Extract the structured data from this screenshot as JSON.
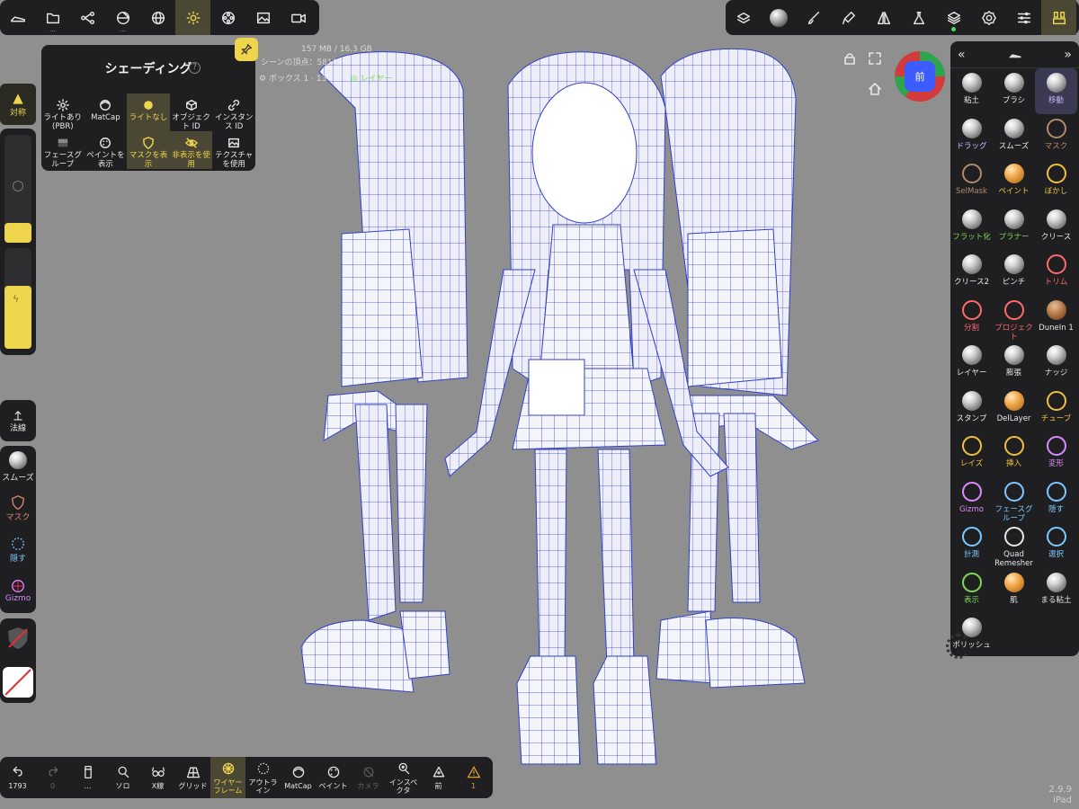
{
  "top_toolbar": {
    "left_icons": [
      "shoe-icon",
      "folder-icon",
      "scene-graph-icon",
      "mesh-icon",
      "sphere-icon",
      "sun-icon",
      "film-reel-icon",
      "image-icon",
      "camera-icon"
    ],
    "right_icons": [
      "stack-icon",
      "matcap-icon",
      "brush-icon",
      "paint-icon",
      "symmetry-icon",
      "flask-icon",
      "layers-icon",
      "settings-icon",
      "sliders-icon",
      "tool-panel-icon"
    ]
  },
  "shading_popup": {
    "title": "シェーディング",
    "help": "?",
    "options": [
      {
        "label": "ライトあり (PBR)",
        "icon": "sun-icon",
        "selected": false
      },
      {
        "label": "MatCap",
        "icon": "matcap-icon",
        "selected": false
      },
      {
        "label": "ライトなし",
        "icon": "circle-icon",
        "selected": true
      },
      {
        "label": "オブジェクト ID",
        "icon": "cube-icon",
        "selected": false
      },
      {
        "label": "インスタンス ID",
        "icon": "link-icon",
        "selected": false
      },
      {
        "label": "フェースグループ",
        "icon": "facegroup-icon",
        "selected": false
      },
      {
        "label": "ペイントを表示",
        "icon": "palette-icon",
        "selected": false
      },
      {
        "label": "マスクを表示",
        "icon": "shield-icon",
        "selected": true
      },
      {
        "label": "非表示を使用",
        "icon": "eye-off-icon",
        "selected": true
      },
      {
        "label": "テクスチャを使用",
        "icon": "image-icon",
        "selected": false
      }
    ]
  },
  "info": {
    "memory": "157 MB / 16.3 GB",
    "scene_vertices": "シーンの頂点：5810",
    "object_name": "ボックス 1",
    "object_vertices": "13",
    "layer_label": "レイヤー"
  },
  "left_panel": {
    "symmetry_label": "対称",
    "normal_label": "法線",
    "smooth_label": "スムーズ",
    "mask_label": "マスク",
    "hide_label": "隠す",
    "gizmo_label": "Gizmo"
  },
  "view_cube": {
    "face": "前"
  },
  "right_panel": {
    "tools": [
      {
        "label": "粘土",
        "style": "ball",
        "color": "#e8e8e8"
      },
      {
        "label": "ブラシ",
        "style": "ball",
        "color": "#e8e8e8"
      },
      {
        "label": "移動",
        "style": "ball",
        "color": "#c9b8ff",
        "active": true
      },
      {
        "label": "ドラッグ",
        "style": "ball",
        "color": "#c9b8ff"
      },
      {
        "label": "スムーズ",
        "style": "ball",
        "color": "#e8e8e8"
      },
      {
        "label": "マスク",
        "style": "icon",
        "color": "#b08a6a"
      },
      {
        "label": "SelMask",
        "style": "icon",
        "color": "#b08a6a"
      },
      {
        "label": "ペイント",
        "style": "ball-o",
        "color": "#f0c040"
      },
      {
        "label": "ぼかし",
        "style": "icon",
        "color": "#f0c040"
      },
      {
        "label": "フラット化",
        "style": "ball",
        "color": "#7ed957"
      },
      {
        "label": "プラナー",
        "style": "ball",
        "color": "#7ed957"
      },
      {
        "label": "クリース",
        "style": "ball",
        "color": "#e8e8e8"
      },
      {
        "label": "クリース2",
        "style": "ball",
        "color": "#e8e8e8"
      },
      {
        "label": "ピンチ",
        "style": "ball",
        "color": "#e8e8e8"
      },
      {
        "label": "トリム",
        "style": "icon",
        "color": "#ff6b6b"
      },
      {
        "label": "分割",
        "style": "icon",
        "color": "#ff6b6b"
      },
      {
        "label": "プロジェクト",
        "style": "icon",
        "color": "#ff6b6b"
      },
      {
        "label": "DuneIn 1",
        "style": "ball-b",
        "color": "#e8e8e8"
      },
      {
        "label": "レイヤー",
        "style": "ball",
        "color": "#e8e8e8"
      },
      {
        "label": "膨張",
        "style": "ball",
        "color": "#e8e8e8"
      },
      {
        "label": "ナッジ",
        "style": "ball",
        "color": "#e8e8e8"
      },
      {
        "label": "スタンプ",
        "style": "ball",
        "color": "#e8e8e8"
      },
      {
        "label": "DelLayer",
        "style": "ball-o",
        "color": "#e8e8e8"
      },
      {
        "label": "チューブ",
        "style": "icon",
        "color": "#f0c040"
      },
      {
        "label": "レイズ",
        "style": "icon",
        "color": "#f0c040"
      },
      {
        "label": "挿入",
        "style": "icon",
        "color": "#f0c040"
      },
      {
        "label": "変形",
        "style": "icon",
        "color": "#d98cff"
      },
      {
        "label": "Gizmo",
        "style": "icon",
        "color": "#d98cff"
      },
      {
        "label": "フェースグループ",
        "style": "icon",
        "color": "#7cc8ff"
      },
      {
        "label": "隠す",
        "style": "icon",
        "color": "#7cc8ff"
      },
      {
        "label": "計測",
        "style": "icon",
        "color": "#7cc8ff"
      },
      {
        "label": "Quad Remesher",
        "style": "icon",
        "color": "#e8e8e8"
      },
      {
        "label": "選択",
        "style": "icon",
        "color": "#7cc8ff"
      },
      {
        "label": "表示",
        "style": "icon",
        "color": "#7ed957"
      },
      {
        "label": "肌",
        "style": "ball-o",
        "color": "#e8e8e8"
      },
      {
        "label": "まる粘土",
        "style": "ball",
        "color": "#e8e8e8"
      },
      {
        "label": "ポリッシュ",
        "style": "ball",
        "color": "#e8e8e8"
      }
    ]
  },
  "bottom_toolbar": {
    "items": [
      {
        "label": "1793",
        "icon": "undo-icon"
      },
      {
        "label": "0",
        "icon": "redo-icon",
        "dim": true
      },
      {
        "label": "...",
        "icon": "phone-icon"
      },
      {
        "label": "ソロ",
        "icon": "search-icon"
      },
      {
        "label": "X線",
        "icon": "glasses-icon"
      },
      {
        "label": "グリッド",
        "icon": "grid-icon"
      },
      {
        "label": "ワイヤーフレーム",
        "icon": "wireframe-icon",
        "on": true
      },
      {
        "label": "アウトライン",
        "icon": "outline-icon"
      },
      {
        "label": "MatCap",
        "icon": "matcap-icon"
      },
      {
        "label": "ペイント",
        "icon": "palette-icon"
      },
      {
        "label": "カメラ",
        "icon": "camera-off-icon",
        "dim": true
      },
      {
        "label": "インスペクタ",
        "icon": "inspector-icon"
      },
      {
        "label": "前",
        "icon": "view-icon"
      },
      {
        "label": "1",
        "icon": "warning-icon",
        "warn": true
      }
    ]
  },
  "version": {
    "number": "2.9.9",
    "device": "iPad"
  },
  "colors": {
    "accent": "#efd54d",
    "panel": "#1f1f21",
    "background": "#8f8f8f",
    "wire": "#2c36c8"
  }
}
